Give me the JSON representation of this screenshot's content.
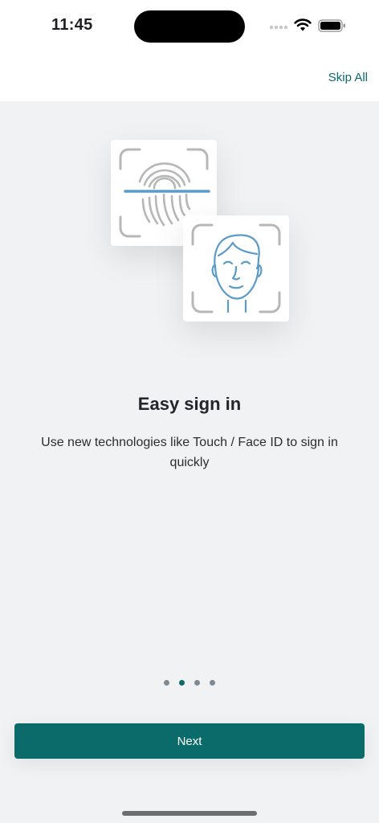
{
  "status_bar": {
    "time": "11:45",
    "icons": [
      "signal-icon",
      "wifi-icon",
      "battery-icon"
    ]
  },
  "header": {
    "skip_label": "Skip All"
  },
  "illustration": {
    "icons": [
      "fingerprint-icon",
      "face-id-icon"
    ],
    "colors": {
      "accent": "#5b9bc9",
      "frame": "#b7b7b7"
    }
  },
  "onboarding": {
    "title": "Easy sign in",
    "description": "Use new technologies like Touch / Face ID to sign in quickly"
  },
  "pager": {
    "pages": 4,
    "current_page": 2
  },
  "footer": {
    "next_label": "Next"
  },
  "colors": {
    "brand": "#0b6b6b",
    "background": "#f1f2f4",
    "inactive_dot": "#7c8a94"
  }
}
